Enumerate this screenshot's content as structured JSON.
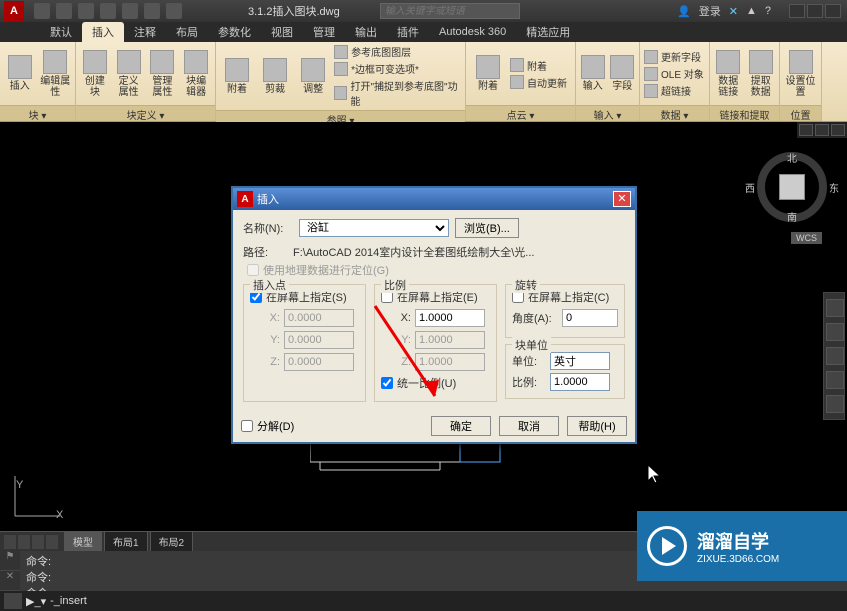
{
  "titlebar": {
    "filename": "3.1.2插入图块.dwg",
    "search_placeholder": "输入关键字或短语",
    "login": "登录",
    "help_icon": "?"
  },
  "ribbon_tabs": [
    "默认",
    "插入",
    "注释",
    "布局",
    "参数化",
    "视图",
    "管理",
    "输出",
    "插件",
    "Autodesk 360",
    "精选应用"
  ],
  "ribbon_active": 1,
  "ribbon_panels": {
    "p1": {
      "label": "块 ▾",
      "b1": "插入",
      "b2": "编辑属性"
    },
    "p2": {
      "label": "块定义 ▾",
      "b1": "创建块",
      "b2": "定义属性",
      "b3": "管理属性",
      "b4": "块编辑器"
    },
    "p3": {
      "label": "参照 ▾",
      "b1": "附着",
      "b2": "剪裁",
      "b3": "调整",
      "r1": "参考底图图层",
      "r2": "*边框可变选项*",
      "r3": "打开\"捕捉到参考底图\"功能"
    },
    "p4": {
      "label": "点云 ▾",
      "b1": "附着",
      "r1": "附着",
      "r2": "自动更新"
    },
    "p5": {
      "label": "输入 ▾",
      "b1": "输入",
      "b2": "字段"
    },
    "p6": {
      "label": "数据 ▾",
      "r1": "更新字段",
      "r2": "OLE 对象",
      "r3": "超链接"
    },
    "p7": {
      "label": "链接和提取",
      "b1": "数据链接",
      "b2": "提取数据"
    },
    "p8": {
      "label": "位置",
      "b1": "设置位置"
    }
  },
  "viewcube": {
    "n": "北",
    "s": "南",
    "e": "东",
    "w": "西"
  },
  "wcs": "WCS",
  "layout_tabs": [
    "模型",
    "布局1",
    "布局2"
  ],
  "cmd_hist": [
    "命令:",
    "命令:",
    "命令:"
  ],
  "cmd_line": "-_insert",
  "cmd_prompt": "▶_▾",
  "dialog": {
    "title": "插入",
    "name_lbl": "名称(N):",
    "name_val": "浴缸",
    "browse": "浏览(B)...",
    "path_lbl": "路径:",
    "path_val": "F:\\AutoCAD 2014室内设计全套图纸绘制大全\\光...",
    "geo_chk": "使用地理数据进行定位(G)",
    "grp_insert": "插入点",
    "grp_scale": "比例",
    "grp_rotate": "旋转",
    "onscreen_s": "在屏幕上指定(S)",
    "onscreen_e": "在屏幕上指定(E)",
    "onscreen_c": "在屏幕上指定(C)",
    "x": "X:",
    "y": "Y:",
    "z": "Z:",
    "xv": "0.0000",
    "yv": "0.0000",
    "zv": "0.0000",
    "sx": "1.0000",
    "sy": "1.0000",
    "sz": "1.0000",
    "uniform": "统一比例(U)",
    "angle_lbl": "角度(A):",
    "angle_v": "0",
    "blockunit": "块单位",
    "unit_lbl": "单位:",
    "unit_v": "英寸",
    "scale_lbl": "比例:",
    "scale_v": "1.0000",
    "explode": "分解(D)",
    "ok": "确定",
    "cancel": "取消",
    "help": "帮助(H)"
  },
  "watermark": {
    "t1": "溜溜自学",
    "t2": "ZIXUE.3D66.COM"
  }
}
